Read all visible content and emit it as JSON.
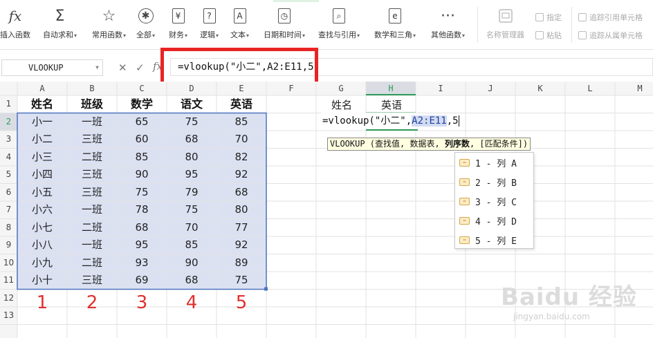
{
  "ribbon": {
    "groups": [
      {
        "label": "插入函数",
        "icon": "fx-icon",
        "glyph": "fx",
        "caret": false
      },
      {
        "label": "自动求和",
        "icon": "sigma-icon",
        "glyph": "Σ",
        "caret": true
      },
      {
        "label": "常用函数",
        "icon": "star-icon",
        "glyph": "☆",
        "caret": true
      },
      {
        "label": "全部",
        "icon": "asterisk-icon",
        "glyph": "✱",
        "caret": true
      },
      {
        "label": "财务",
        "icon": "yen-icon",
        "glyph": "¥",
        "caret": true
      },
      {
        "label": "逻辑",
        "icon": "question-icon",
        "glyph": "?",
        "caret": true
      },
      {
        "label": "文本",
        "icon": "text-a-icon",
        "glyph": "A",
        "caret": true
      },
      {
        "label": "日期和时间",
        "icon": "clock-icon",
        "glyph": "◷",
        "caret": true
      },
      {
        "label": "查找与引用",
        "icon": "search-doc-icon",
        "glyph": "⌕",
        "caret": true
      },
      {
        "label": "数学和三角",
        "icon": "math-e-icon",
        "glyph": "e",
        "caret": true
      },
      {
        "label": "其他函数",
        "icon": "more-dots-icon",
        "glyph": "···",
        "caret": true
      }
    ],
    "name_manager": "名称管理器",
    "define": "指定",
    "paste": "粘贴",
    "trace_precedents": "追踪引用单元格",
    "trace_dependents": "追踪从属单元格"
  },
  "formula_bar": {
    "name_box": "VLOOKUP",
    "fx": "fx",
    "formula": "=vlookup(\"小二\",A2:E11,5",
    "cancel_glyph": "✕",
    "confirm_glyph": "✓"
  },
  "columns": [
    "A",
    "B",
    "C",
    "D",
    "E",
    "F",
    "G",
    "H",
    "I",
    "J",
    "K",
    "L",
    "M"
  ],
  "rows": [
    "1",
    "2",
    "3",
    "4",
    "5",
    "6",
    "7",
    "8",
    "9",
    "10",
    "11",
    "12",
    "13"
  ],
  "table": {
    "headers": [
      "姓名",
      "班级",
      "数学",
      "语文",
      "英语"
    ],
    "data": [
      [
        "小一",
        "一班",
        "65",
        "75",
        "85"
      ],
      [
        "小二",
        "三班",
        "60",
        "68",
        "70"
      ],
      [
        "小三",
        "二班",
        "85",
        "80",
        "82"
      ],
      [
        "小四",
        "三班",
        "90",
        "95",
        "92"
      ],
      [
        "小五",
        "三班",
        "75",
        "79",
        "68"
      ],
      [
        "小六",
        "一班",
        "78",
        "75",
        "80"
      ],
      [
        "小七",
        "二班",
        "68",
        "70",
        "77"
      ],
      [
        "小八",
        "一班",
        "95",
        "85",
        "92"
      ],
      [
        "小九",
        "二班",
        "93",
        "90",
        "89"
      ],
      [
        "小十",
        "三班",
        "69",
        "68",
        "75"
      ]
    ]
  },
  "lookup": {
    "g1": "姓名",
    "h1": "英语"
  },
  "editing_cell": {
    "prefix": "=vlookup(\"小二\",",
    "ref": "A2:E11",
    "suffix": ",5"
  },
  "column_numbers": [
    "1",
    "2",
    "3",
    "4",
    "5"
  ],
  "tooltip": {
    "prefix": "VLOOKUP (查找值, 数据表, ",
    "bold": "列序数",
    "suffix": ", [匹配条件])"
  },
  "dropdown": [
    "1 - 列 A",
    "2 - 列 B",
    "3 - 列 C",
    "4 - 列 D",
    "5 - 列 E"
  ],
  "watermark": {
    "main": "Baidu 经验",
    "sub": "jingyan.baidu.com"
  },
  "colors": {
    "grid_line": "#e2e2e2",
    "header_bg": "#f5f5f5",
    "selection_fill": "#dce1f2",
    "selection_border": "#4d73bf",
    "red": "#e0302e",
    "active_header": "#d9dde3",
    "active_green": "#2e9b59"
  }
}
